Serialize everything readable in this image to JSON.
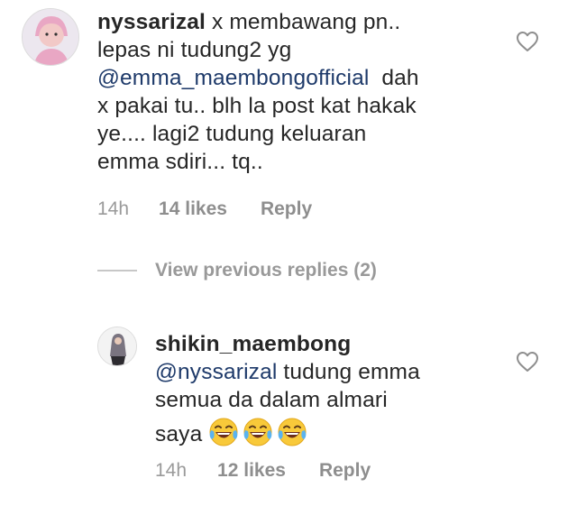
{
  "comment": {
    "username": "nyssarizal",
    "line1_text": "x membawang pn..",
    "line2": "lepas ni tudung2 yg",
    "mention": "@emma_maembongofficial",
    "line3_rest": "dah",
    "line4": "x pakai tu.. blh la post kat hakak",
    "line5": "ye.... lagi2 tudung keluaran",
    "line6": "emma sdiri... tq..",
    "time": "14h",
    "likes": "14 likes",
    "reply": "Reply"
  },
  "view_replies": "View previous replies (2)",
  "reply_comment": {
    "username": "shikin_maembong",
    "mention": "@nyssarizal",
    "line1_rest": "tudung emma",
    "line2": "semua da dalam almari",
    "line3": "saya",
    "emojis": [
      "face-with-tears-of-joy-icon",
      "face-with-tears-of-joy-icon",
      "face-with-tears-of-joy-icon"
    ],
    "time": "14h",
    "likes": "12 likes",
    "reply": "Reply"
  },
  "colors": {
    "mention": "#1e3a6a",
    "meta": "#8e8e8e",
    "text": "#262626"
  }
}
